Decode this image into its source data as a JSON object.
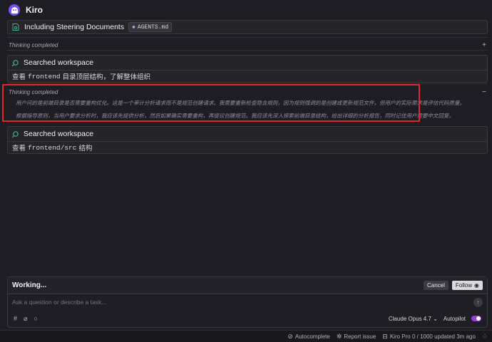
{
  "app": {
    "title": "Kiro",
    "logo_icon": "kiro-ghost-logo"
  },
  "steering": {
    "label": "Including Steering Documents",
    "chip": "AGENTS.md"
  },
  "thinking1": {
    "label": "Thinking completed",
    "toggle": "+"
  },
  "search1": {
    "title": "Searched workspace",
    "body_prefix": "查看",
    "body_code": "frontend",
    "body_suffix": "目录顶层结构，了解整体组织"
  },
  "thinking2": {
    "label": "Thinking completed",
    "toggle": "−",
    "line1": "用户问的是前端目录是否需要重构优化。这是一个审计分析请求而不是规范创建请求。我需要重新检查隐含规则，因为规则强调的是创建或更新规范文件，但用户的实际需求是评估代码质量。",
    "line2": "根据指导原则，当用户要求分析时，我应该先提供分析，然后如果确实需要重构，再提议创建规范。我应该先深入探索前端目录结构，给出详细的分析报告，同时记住用户需要中文回复。"
  },
  "search2": {
    "title": "Searched workspace",
    "body_prefix": "查看",
    "body_code": "frontend/src",
    "body_suffix": "结构"
  },
  "panel": {
    "status": "Working...",
    "cancel": "Cancel",
    "follow": "Follow",
    "placeholder": "Ask a question or describe a task...",
    "model": "Claude Opus 4.7",
    "autopilot": "Autopilot",
    "autopilot_on": true
  },
  "statusbar": {
    "autocomplete": "Autocomplete",
    "report": "Report issue",
    "plan": "Kiro Pro 0 / 1000 updated 3m ago"
  },
  "colors": {
    "accent": "#7c4dff",
    "highlight_border": "#e0262a",
    "toggle_on": "#9b3bd6"
  }
}
